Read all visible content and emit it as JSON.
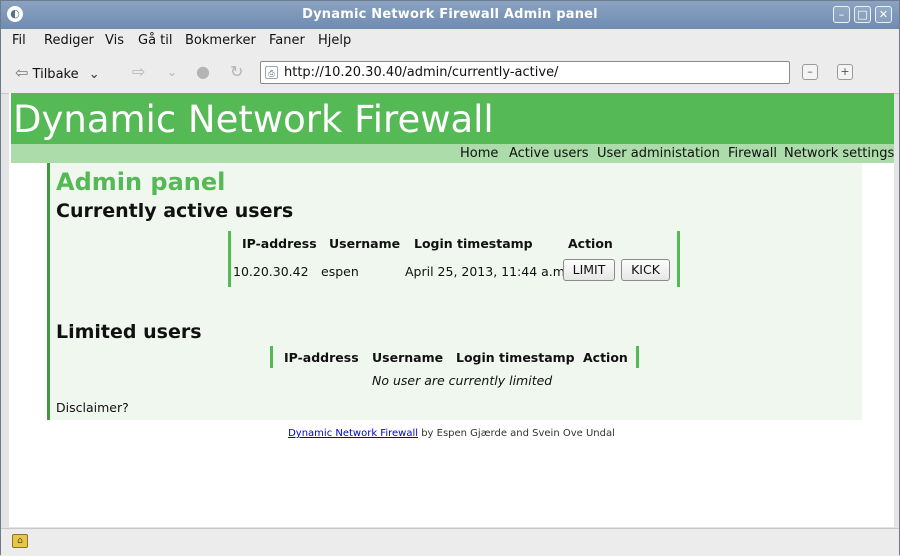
{
  "window": {
    "title": "Dynamic Network Firewall Admin panel",
    "app_icon": "firefox-icon",
    "buttons": [
      "minimize-icon",
      "maximize-icon",
      "close-icon"
    ]
  },
  "menu": {
    "items": [
      "Fil",
      "Rediger",
      "Vis",
      "Gå til",
      "Bokmerker",
      "Faner",
      "Hjelp"
    ]
  },
  "toolbar": {
    "back_label": "Tilbake",
    "url": "http://10.20.30.40/admin/currently-active/"
  },
  "site": {
    "title": "Dynamic Network Firewall",
    "nav": [
      "Home",
      "Active users",
      "User administation",
      "Firewall",
      "Network settings"
    ],
    "accent_color": "#55b955",
    "light_accent_color": "#acdca9"
  },
  "panel": {
    "heading": "Admin panel",
    "active_section": "Currently active users",
    "limited_section": "Limited users",
    "columns": [
      "IP-address",
      "Username",
      "Login timestamp",
      "Action"
    ],
    "active_rows": [
      {
        "ip": "10.20.30.42",
        "username": "espen",
        "timestamp": "April 25, 2013, 11:44 a.m.",
        "actions": [
          "LIMIT",
          "KICK"
        ]
      }
    ],
    "limited_empty_message": "No user are currently limited",
    "disclaimer": "Disclaimer?"
  },
  "footer": {
    "link_text": "Dynamic Network Firewall",
    "credit_text": " by Espen Gjærde and Svein Ove Undal"
  }
}
